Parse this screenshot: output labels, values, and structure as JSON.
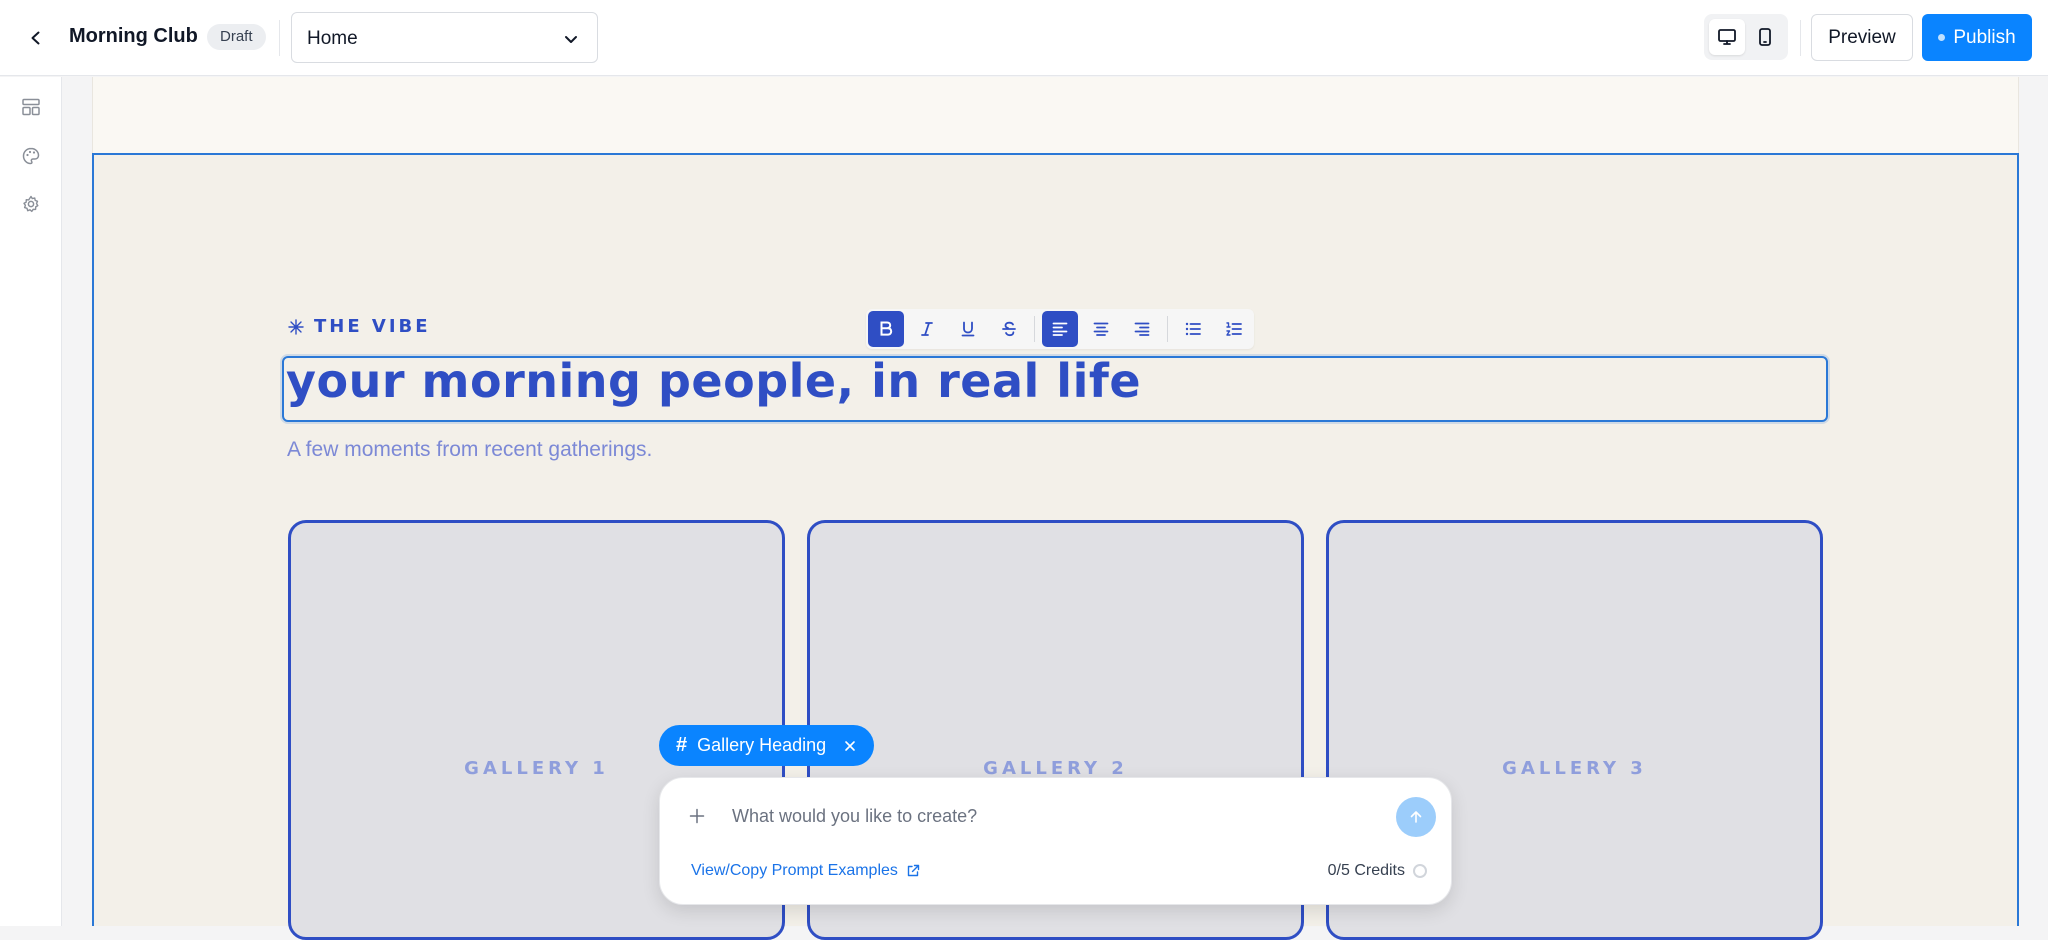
{
  "topbar": {
    "site_name": "Morning Club",
    "status_badge": "Draft",
    "page_select": "Home",
    "preview_label": "Preview",
    "publish_label": "Publish"
  },
  "rail": {
    "items": [
      "layout-icon",
      "palette-icon",
      "gear-icon"
    ]
  },
  "section": {
    "eyebrow": "THE VIBE",
    "heading": "your morning people, in real life",
    "subheading": "A few moments from recent gatherings.",
    "gallery": [
      "GALLERY 1",
      "GALLERY 2",
      "GALLERY 3"
    ]
  },
  "formatting_toolbar": {
    "buttons": [
      "bold",
      "italic",
      "underline",
      "strikethrough",
      "align-left",
      "align-center",
      "align-right",
      "bullet-list",
      "numbered-list"
    ],
    "active": [
      "bold",
      "align-left"
    ]
  },
  "ai_prompt": {
    "context_chip": "Gallery Heading",
    "placeholder": "What would you like to create?",
    "examples_link": "View/Copy Prompt Examples",
    "credits": "0/5 Credits"
  },
  "colors": {
    "accent": "#0a84ff",
    "brand_blue": "#2f4ec4",
    "selection": "#2a78d6",
    "section_bg": "#f3f0e9"
  }
}
